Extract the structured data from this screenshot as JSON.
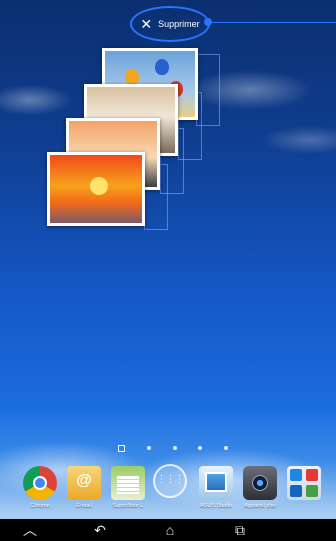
{
  "remove_target": {
    "label": "Supprimer",
    "icon": "close-icon"
  },
  "photo_widget": {
    "photos": [
      "sunset-sea",
      "beach-pier",
      "sunset-pier",
      "balloons-sky"
    ]
  },
  "pager": {
    "count": 5,
    "current": 0
  },
  "dock": {
    "items": [
      {
        "label": "Chrome",
        "icon": "chrome-icon"
      },
      {
        "label": "E-mail",
        "icon": "email-icon"
      },
      {
        "label": "SuperNote L",
        "icon": "supernote-icon"
      },
      {
        "label": "",
        "icon": "all-apps-icon"
      },
      {
        "label": "ASUS Studio",
        "icon": "asus-studio-icon"
      },
      {
        "label": "Appareil pho",
        "icon": "camera-icon"
      },
      {
        "label": "",
        "icon": "google-folder-icon"
      }
    ]
  },
  "navigation": {
    "back": "back-icon",
    "home": "home-icon",
    "recents": "recent-apps-icon",
    "hide": "hide-keyboard-icon"
  },
  "colors": {
    "accent": "#2a73ff",
    "navbar": "#000000"
  }
}
